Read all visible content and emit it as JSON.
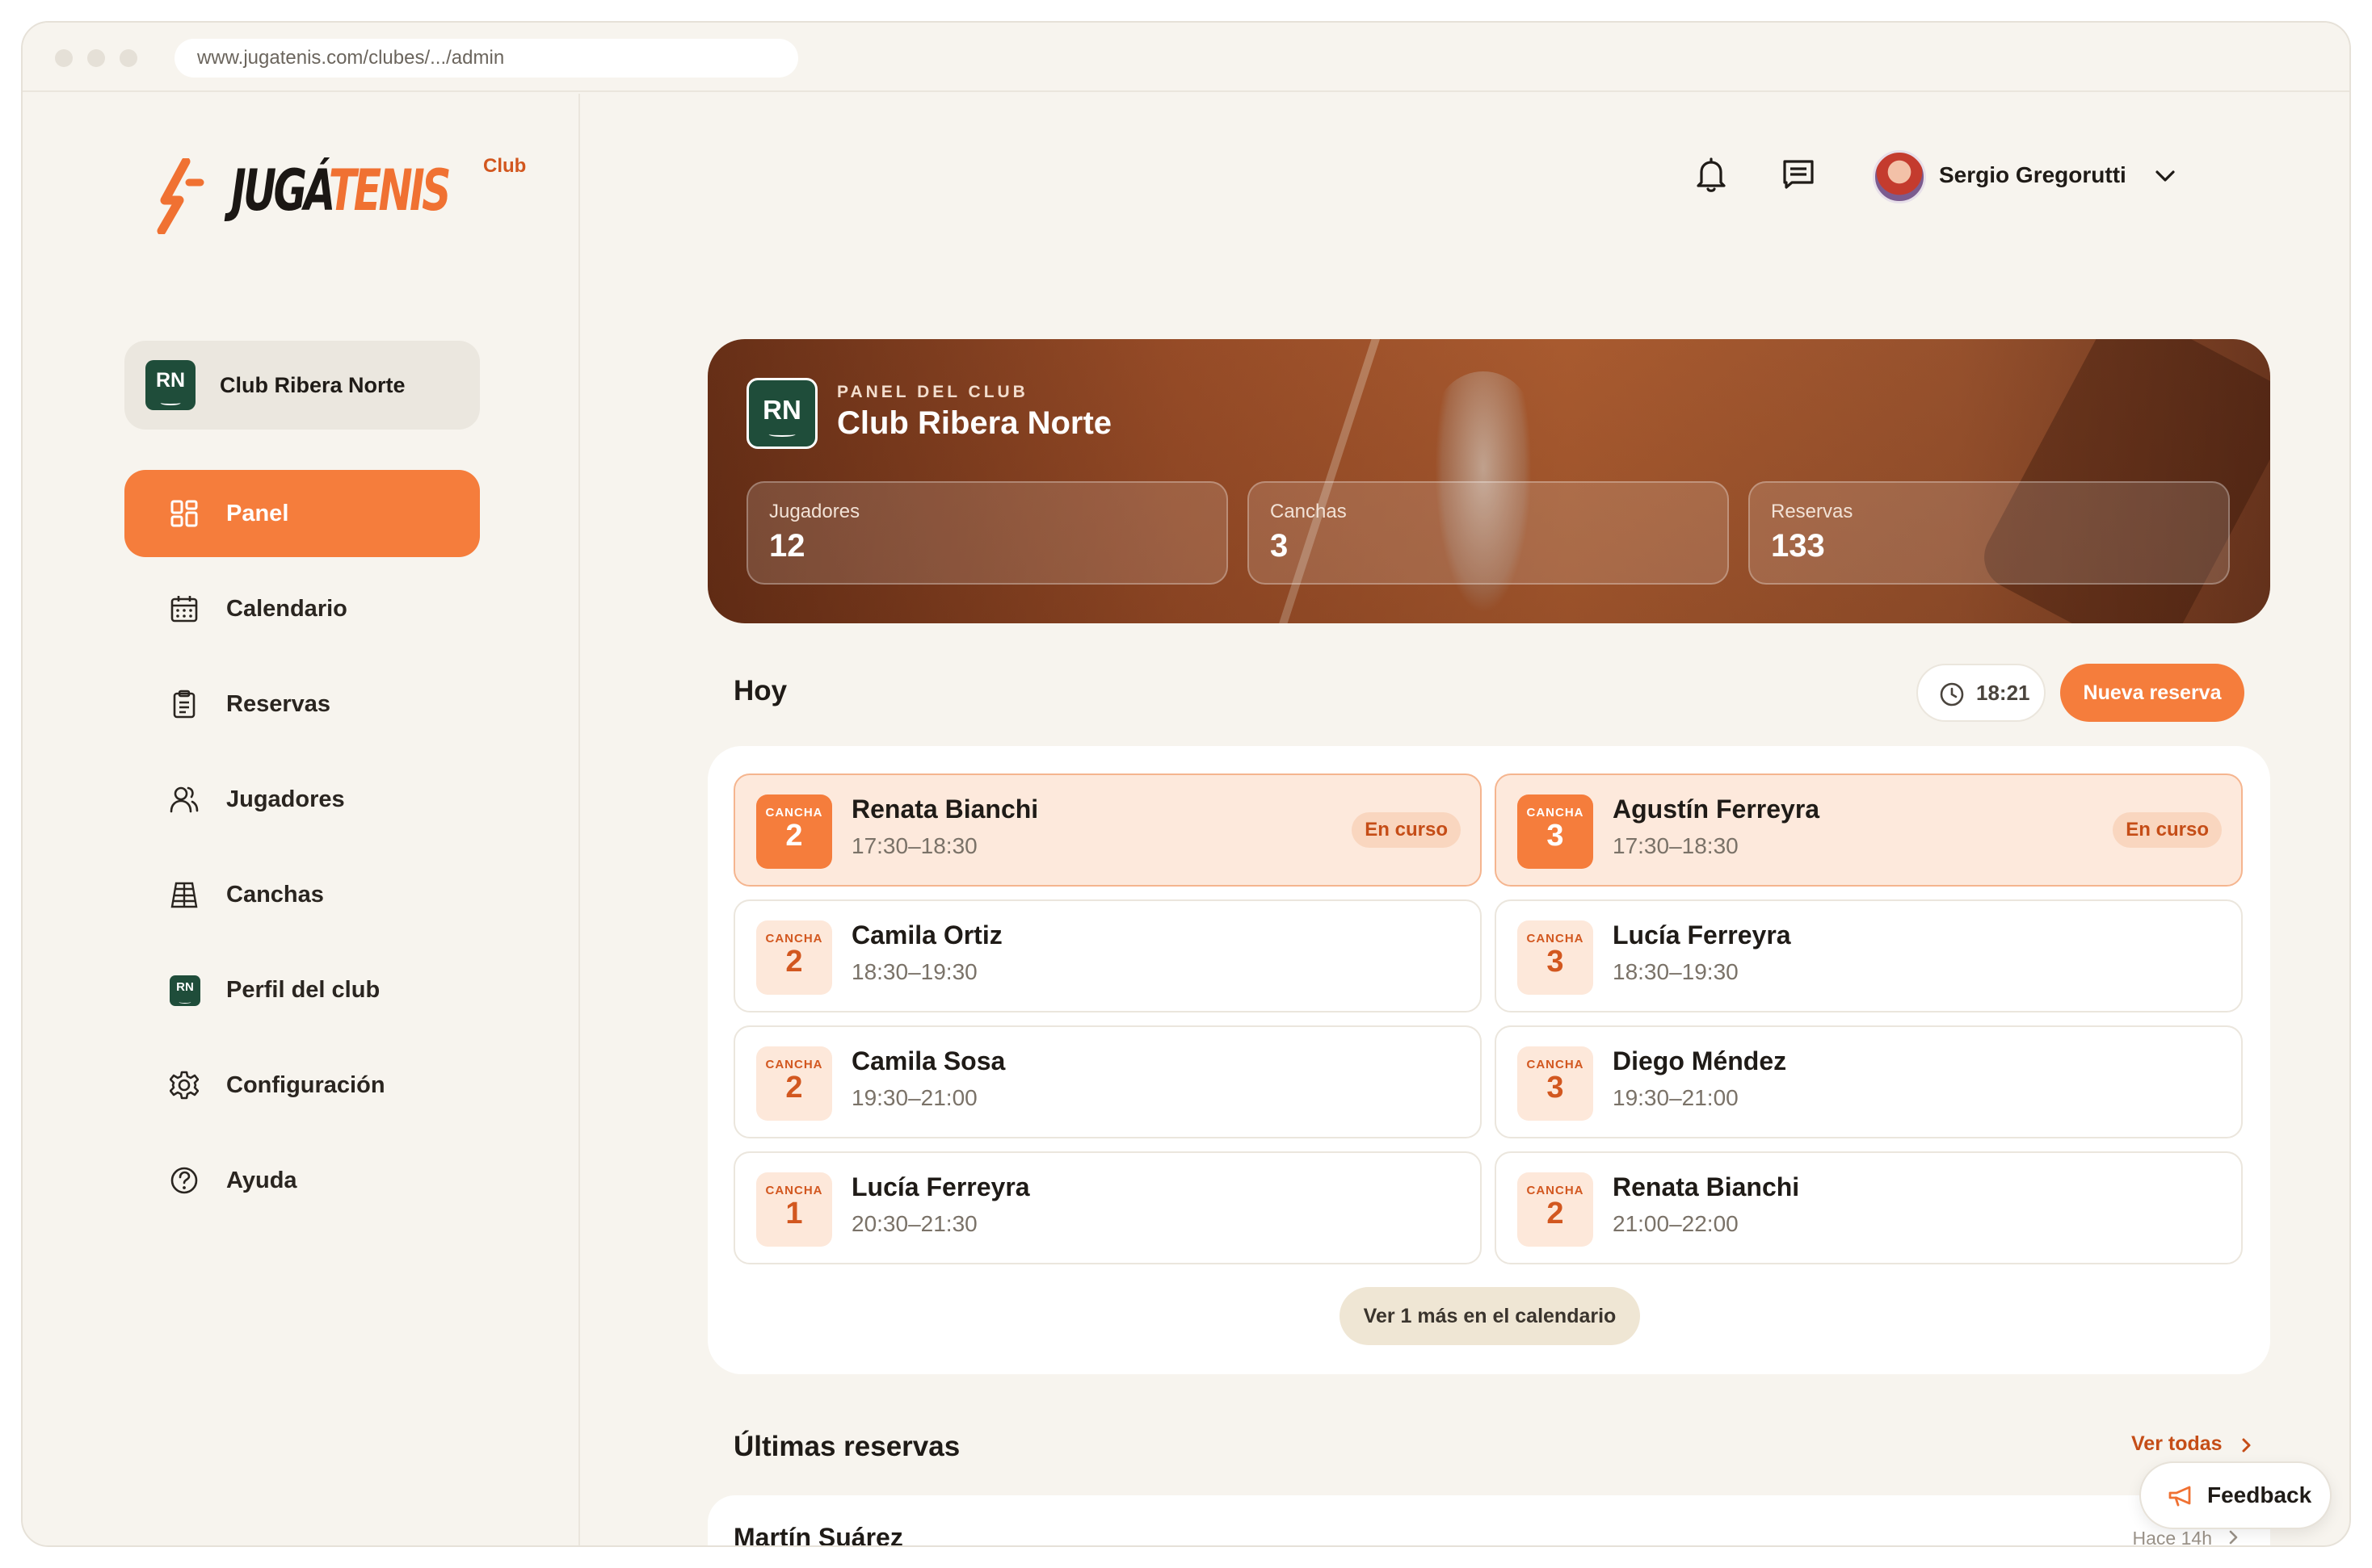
{
  "browser": {
    "url": "www.jugatenis.com/clubes/.../admin"
  },
  "logo": {
    "text_dark": "JUGÁ",
    "text_orange": "TENIS",
    "badge": "Club"
  },
  "club_selector": {
    "initials": "RN",
    "name": "Club Ribera Norte"
  },
  "sidebar": {
    "items": [
      {
        "label": "Panel",
        "icon": "grid-icon",
        "active": true
      },
      {
        "label": "Calendario",
        "icon": "calendar-icon"
      },
      {
        "label": "Reservas",
        "icon": "clipboard-icon"
      },
      {
        "label": "Jugadores",
        "icon": "users-icon"
      },
      {
        "label": "Canchas",
        "icon": "court-icon"
      },
      {
        "label": "Perfil del club",
        "icon": "club-badge-icon"
      },
      {
        "label": "Configuración",
        "icon": "gear-icon"
      },
      {
        "label": "Ayuda",
        "icon": "help-icon"
      }
    ]
  },
  "header": {
    "user_name": "Sergio Gregorutti"
  },
  "hero": {
    "initials": "RN",
    "eyebrow": "PANEL DEL CLUB",
    "title": "Club Ribera Norte",
    "stats": [
      {
        "label": "Jugadores",
        "value": "12"
      },
      {
        "label": "Canchas",
        "value": "3"
      },
      {
        "label": "Reservas",
        "value": "133"
      }
    ]
  },
  "today": {
    "title": "Hoy",
    "time": "18:21",
    "new_booking": "Nueva reserva",
    "court_label": "CANCHA",
    "bookings": [
      {
        "court": "2",
        "player": "Renata Bianchi",
        "time": "17:30–18:30",
        "status": "En curso"
      },
      {
        "court": "3",
        "player": "Agustín Ferreyra",
        "time": "17:30–18:30",
        "status": "En curso"
      },
      {
        "court": "2",
        "player": "Camila Ortiz",
        "time": "18:30–19:30"
      },
      {
        "court": "3",
        "player": "Lucía Ferreyra",
        "time": "18:30–19:30"
      },
      {
        "court": "2",
        "player": "Camila Sosa",
        "time": "19:30–21:00"
      },
      {
        "court": "3",
        "player": "Diego Méndez",
        "time": "19:30–21:00"
      },
      {
        "court": "1",
        "player": "Lucía Ferreyra",
        "time": "20:30–21:30"
      },
      {
        "court": "2",
        "player": "Renata Bianchi",
        "time": "21:00–22:00"
      }
    ],
    "more_button": "Ver 1 más en el calendario"
  },
  "latest": {
    "title": "Últimas reservas",
    "see_all": "Ver todas",
    "items": [
      {
        "player": "Martín Suárez",
        "when": "Hace 14h"
      }
    ]
  },
  "feedback": {
    "label": "Feedback"
  },
  "colors": {
    "accent": "#f57d3c",
    "club_green": "#1f4d3a",
    "background": "#f7f4ee"
  }
}
